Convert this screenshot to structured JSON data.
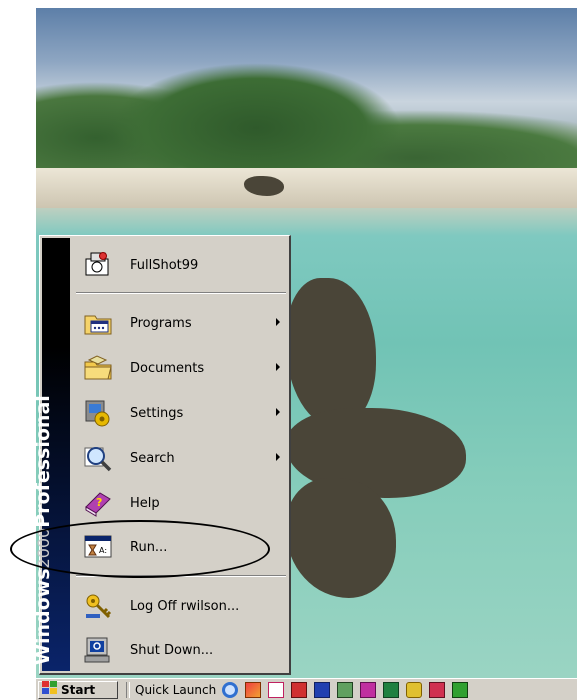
{
  "start_menu": {
    "banner_main": "Windows",
    "banner_year": "2000",
    "banner_edition": "Professional",
    "items": [
      {
        "label": "FullShot99",
        "icon": "camera-icon"
      },
      {
        "label": "Programs",
        "icon": "programs-folder-icon",
        "submenu": true
      },
      {
        "label": "Documents",
        "icon": "documents-folder-icon",
        "submenu": true
      },
      {
        "label": "Settings",
        "icon": "settings-icon",
        "submenu": true
      },
      {
        "label": "Search",
        "icon": "search-icon",
        "submenu": true
      },
      {
        "label": "Help",
        "icon": "help-book-icon"
      },
      {
        "label": "Run...",
        "icon": "run-icon"
      },
      {
        "label": "Log Off rwilson...",
        "icon": "key-icon"
      },
      {
        "label": "Shut Down...",
        "icon": "shutdown-icon"
      }
    ]
  },
  "taskbar": {
    "start_label": "Start",
    "quick_launch_label": "Quick Launch",
    "quick_launch_icons": [
      "internet-explorer-icon",
      "paint-icon",
      "draw-icon",
      "powerpoint-icon",
      "word-icon",
      "picture-icon",
      "publisher-icon",
      "excel-icon",
      "clock-icon",
      "access-icon",
      "green-app-icon"
    ]
  },
  "colors": {
    "menu_face": "#d4d0c8",
    "banner_dark": "#000000",
    "banner_blue": "#0a246a",
    "annotation": "#000000"
  }
}
